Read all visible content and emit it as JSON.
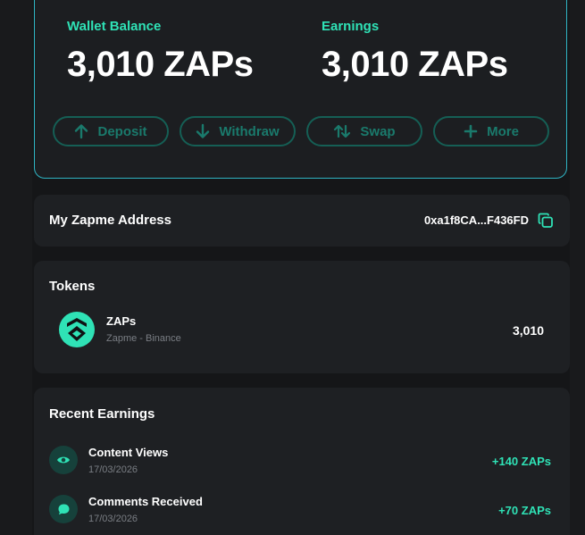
{
  "wallet": {
    "balance_label": "Wallet Balance",
    "balance_value": "3,010 ZAPs",
    "earnings_label": "Earnings",
    "earnings_value": "3,010 ZAPs",
    "actions": [
      {
        "label": "Deposit",
        "icon": "arrow-up-icon"
      },
      {
        "label": "Withdraw",
        "icon": "arrow-down-icon"
      },
      {
        "label": "Swap",
        "icon": "swap-icon"
      },
      {
        "label": "More",
        "icon": "plus-icon"
      }
    ]
  },
  "address": {
    "title": "My Zapme Address",
    "value": "0xa1f8CA...F436FD",
    "copy_icon": "copy-icon"
  },
  "tokens": {
    "title": "Tokens",
    "items": [
      {
        "name": "ZAPs",
        "network": "Zapme - Binance",
        "amount": "3,010",
        "icon": "zapme-logo-icon"
      }
    ]
  },
  "earnings": {
    "title": "Recent Earnings",
    "items": [
      {
        "title": "Content Views",
        "date": "17/03/2026",
        "amount": "+140 ZAPs",
        "icon": "eye-icon"
      },
      {
        "title": "Comments Received",
        "date": "17/03/2026",
        "amount": "+70 ZAPs",
        "icon": "chat-bubble-icon"
      }
    ]
  },
  "colors": {
    "accent": "#2fe2b6",
    "border": "#2fb5c4",
    "button_border": "#155f55",
    "background": "#151618",
    "card": "#1e2023"
  }
}
